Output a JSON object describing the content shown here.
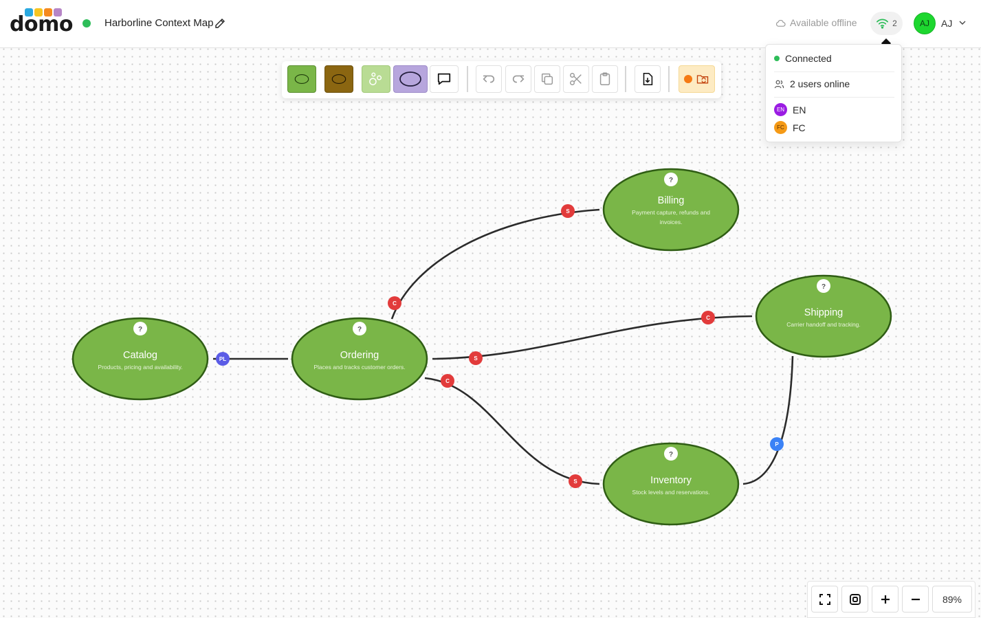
{
  "app": {
    "logo_text": "domo",
    "logo_colors": [
      "#2aa9e0",
      "#f7c521",
      "#f58a1f",
      "#b685c6"
    ],
    "status_color": "#2ebd59",
    "title": "Harborline Context Map"
  },
  "header": {
    "offline_label": "Available offline",
    "connection_count": "2",
    "user_avatar": "AJ",
    "user_initials": "AJ",
    "user_avatar_color": "#1dd72f"
  },
  "popover": {
    "status": "Connected",
    "status_color": "#2ebd59",
    "users_online": "2 users online",
    "users": [
      {
        "initials": "EN",
        "label": "EN",
        "color": "#9b1ce3"
      },
      {
        "initials": "FC",
        "label": "FC",
        "color": "#f59a16"
      }
    ]
  },
  "toolbar": {
    "tools": [
      {
        "name": "core-domain-ellipse",
        "fill": "#7ab648",
        "stroke": "#2f5d14"
      },
      {
        "name": "generic-domain-ellipse",
        "fill": "#8b6611",
        "stroke": "#3a2a06"
      },
      {
        "name": "supporting-subdomain-bubbles",
        "fill": "#b9dc94",
        "stroke": "#ffffff"
      },
      {
        "name": "external-system-ellipse",
        "fill": "#b7a6dd",
        "stroke": "#3d3560"
      },
      {
        "name": "comment"
      }
    ],
    "actions": [
      "undo",
      "redo",
      "copy",
      "cut",
      "paste",
      "export",
      "presence"
    ]
  },
  "nodes": [
    {
      "id": "catalog",
      "title": "Catalog",
      "desc": [
        "Products, pricing and availability."
      ],
      "q": "?"
    },
    {
      "id": "ordering",
      "title": "Ordering",
      "desc": [
        "Places and tracks customer orders."
      ],
      "q": "?"
    },
    {
      "id": "billing",
      "title": "Billing",
      "desc": [
        "Payment capture, refunds and",
        "invoices."
      ],
      "q": "?"
    },
    {
      "id": "shipping",
      "title": "Shipping",
      "desc": [
        "Carrier handoff and tracking."
      ],
      "q": "?"
    },
    {
      "id": "inventory",
      "title": "Inventory",
      "desc": [
        "Stock levels and reservations."
      ],
      "q": "?"
    }
  ],
  "node_style": {
    "fill": "#7ab648",
    "stroke": "#2f5d14"
  },
  "relations": [
    {
      "id": "catalog-ordering",
      "badges": [
        {
          "label": "PL",
          "color": "#5b5ce6"
        }
      ]
    },
    {
      "id": "ordering-billing",
      "badges": [
        {
          "label": "C",
          "color": "#e23b3b"
        },
        {
          "label": "S",
          "color": "#e23b3b"
        }
      ]
    },
    {
      "id": "ordering-shipping",
      "badges": [
        {
          "label": "S",
          "color": "#e23b3b"
        },
        {
          "label": "C",
          "color": "#e23b3b"
        }
      ]
    },
    {
      "id": "ordering-inventory",
      "badges": [
        {
          "label": "C",
          "color": "#e23b3b"
        },
        {
          "label": "S",
          "color": "#e23b3b"
        }
      ]
    },
    {
      "id": "shipping-inventory",
      "badges": [
        {
          "label": "P",
          "color": "#3b82f6"
        }
      ]
    }
  ],
  "zoom": {
    "level": "89%"
  }
}
